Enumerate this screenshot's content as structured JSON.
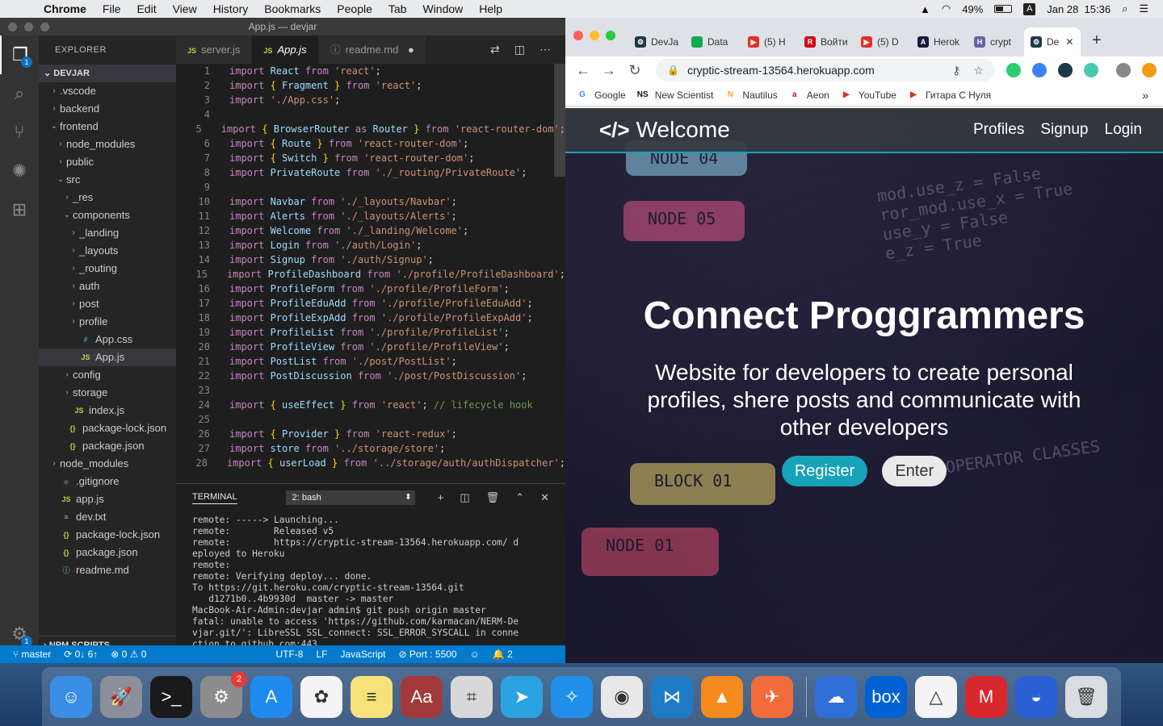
{
  "menubar": {
    "app": "Chrome",
    "items": [
      "File",
      "Edit",
      "View",
      "History",
      "Bookmarks",
      "People",
      "Tab",
      "Window",
      "Help"
    ],
    "battery": "49%",
    "input_source": "A",
    "datetime": "Jan 28  15:36"
  },
  "vscode": {
    "title": "App.js — devjar",
    "explorer_header": "EXPLORER",
    "project": "DEVJAR",
    "activity_badge": "1",
    "settings_badge": "1",
    "tree": [
      {
        "label": ".vscode",
        "indent": 1,
        "type": "folder-closed"
      },
      {
        "label": "backend",
        "indent": 1,
        "type": "folder-closed"
      },
      {
        "label": "frontend",
        "indent": 1,
        "type": "folder-open"
      },
      {
        "label": "node_modules",
        "indent": 2,
        "type": "folder-closed"
      },
      {
        "label": "public",
        "indent": 2,
        "type": "folder-closed"
      },
      {
        "label": "src",
        "indent": 2,
        "type": "folder-open"
      },
      {
        "label": "_res",
        "indent": 3,
        "type": "folder-closed"
      },
      {
        "label": "components",
        "indent": 3,
        "type": "folder-open"
      },
      {
        "label": "_landing",
        "indent": 4,
        "type": "folder-closed"
      },
      {
        "label": "_layouts",
        "indent": 4,
        "type": "folder-closed"
      },
      {
        "label": "_routing",
        "indent": 4,
        "type": "folder-closed"
      },
      {
        "label": "auth",
        "indent": 4,
        "type": "folder-closed"
      },
      {
        "label": "post",
        "indent": 4,
        "type": "folder-closed"
      },
      {
        "label": "profile",
        "indent": 4,
        "type": "folder-closed"
      },
      {
        "label": "App.css",
        "indent": 4,
        "type": "css"
      },
      {
        "label": "App.js",
        "indent": 4,
        "type": "js",
        "selected": true
      },
      {
        "label": "config",
        "indent": 3,
        "type": "folder-closed"
      },
      {
        "label": "storage",
        "indent": 3,
        "type": "folder-closed"
      },
      {
        "label": "index.js",
        "indent": 3,
        "type": "js"
      },
      {
        "label": "package-lock.json",
        "indent": 2,
        "type": "json"
      },
      {
        "label": "package.json",
        "indent": 2,
        "type": "json"
      },
      {
        "label": "node_modules",
        "indent": 1,
        "type": "folder-closed"
      },
      {
        "label": ".gitignore",
        "indent": 1,
        "type": "git"
      },
      {
        "label": "app.js",
        "indent": 1,
        "type": "js"
      },
      {
        "label": "dev.txt",
        "indent": 1,
        "type": "txt"
      },
      {
        "label": "package-lock.json",
        "indent": 1,
        "type": "json"
      },
      {
        "label": "package.json",
        "indent": 1,
        "type": "json"
      },
      {
        "label": "readme.md",
        "indent": 1,
        "type": "info"
      }
    ],
    "npm_scripts": "NPM SCRIPTS",
    "tabs": [
      {
        "label": "server.js",
        "icon": "JS"
      },
      {
        "label": "App.js",
        "icon": "JS",
        "active": true
      },
      {
        "label": "readme.md",
        "icon": "ⓘ",
        "dirty": "●"
      }
    ],
    "code_lines": [
      [
        [
          "kw",
          "import "
        ],
        [
          "id",
          "React"
        ],
        [
          "kw",
          " from "
        ],
        [
          "str",
          "'react'"
        ],
        [
          "code",
          ";"
        ]
      ],
      [
        [
          "kw",
          "import "
        ],
        [
          "pn",
          "{ "
        ],
        [
          "id",
          "Fragment"
        ],
        [
          "pn",
          " }"
        ],
        [
          "kw",
          " from "
        ],
        [
          "str",
          "'react'"
        ],
        [
          "code",
          ";"
        ]
      ],
      [
        [
          "kw",
          "import "
        ],
        [
          "str",
          "'./App.css'"
        ],
        [
          "code",
          ";"
        ]
      ],
      [],
      [
        [
          "kw",
          "import "
        ],
        [
          "pn",
          "{ "
        ],
        [
          "id",
          "BrowserRouter"
        ],
        [
          "kw",
          " as "
        ],
        [
          "id",
          "Router"
        ],
        [
          "pn",
          " }"
        ],
        [
          "kw",
          " from "
        ],
        [
          "str",
          "'react-router-dom'"
        ],
        [
          "code",
          ";"
        ]
      ],
      [
        [
          "kw",
          "import "
        ],
        [
          "pn",
          "{ "
        ],
        [
          "id",
          "Route"
        ],
        [
          "pn",
          " }"
        ],
        [
          "kw",
          " from "
        ],
        [
          "str",
          "'react-router-dom'"
        ],
        [
          "code",
          ";"
        ]
      ],
      [
        [
          "kw",
          "import "
        ],
        [
          "pn",
          "{ "
        ],
        [
          "id",
          "Switch"
        ],
        [
          "pn",
          " }"
        ],
        [
          "kw",
          " from "
        ],
        [
          "str",
          "'react-router-dom'"
        ],
        [
          "code",
          ";"
        ]
      ],
      [
        [
          "kw",
          "import "
        ],
        [
          "id",
          "PrivateRoute"
        ],
        [
          "kw",
          " from "
        ],
        [
          "str",
          "'./_routing/PrivateRoute'"
        ],
        [
          "code",
          ";"
        ]
      ],
      [],
      [
        [
          "kw",
          "import "
        ],
        [
          "id",
          "Navbar"
        ],
        [
          "kw",
          " from "
        ],
        [
          "str",
          "'./_layouts/Navbar'"
        ],
        [
          "code",
          ";"
        ]
      ],
      [
        [
          "kw",
          "import "
        ],
        [
          "id",
          "Alerts"
        ],
        [
          "kw",
          " from "
        ],
        [
          "str",
          "'./_layouts/Alerts'"
        ],
        [
          "code",
          ";"
        ]
      ],
      [
        [
          "kw",
          "import "
        ],
        [
          "id",
          "Welcome"
        ],
        [
          "kw",
          " from "
        ],
        [
          "str",
          "'./_landing/Welcome'"
        ],
        [
          "code",
          ";"
        ]
      ],
      [
        [
          "kw",
          "import "
        ],
        [
          "id",
          "Login"
        ],
        [
          "kw",
          " from "
        ],
        [
          "str",
          "'./auth/Login'"
        ],
        [
          "code",
          ";"
        ]
      ],
      [
        [
          "kw",
          "import "
        ],
        [
          "id",
          "Signup"
        ],
        [
          "kw",
          " from "
        ],
        [
          "str",
          "'./auth/Signup'"
        ],
        [
          "code",
          ";"
        ]
      ],
      [
        [
          "kw",
          "import "
        ],
        [
          "id",
          "ProfileDashboard"
        ],
        [
          "kw",
          " from "
        ],
        [
          "str",
          "'./profile/ProfileDashboard'"
        ],
        [
          "code",
          ";"
        ]
      ],
      [
        [
          "kw",
          "import "
        ],
        [
          "id",
          "ProfileForm"
        ],
        [
          "kw",
          " from "
        ],
        [
          "str",
          "'./profile/ProfileForm'"
        ],
        [
          "code",
          ";"
        ]
      ],
      [
        [
          "kw",
          "import "
        ],
        [
          "id",
          "ProfileEduAdd"
        ],
        [
          "kw",
          " from "
        ],
        [
          "str",
          "'./profile/ProfileEduAdd'"
        ],
        [
          "code",
          ";"
        ]
      ],
      [
        [
          "kw",
          "import "
        ],
        [
          "id",
          "ProfileExpAdd"
        ],
        [
          "kw",
          " from "
        ],
        [
          "str",
          "'./profile/ProfileExpAdd'"
        ],
        [
          "code",
          ";"
        ]
      ],
      [
        [
          "kw",
          "import "
        ],
        [
          "id",
          "ProfileList"
        ],
        [
          "kw",
          " from "
        ],
        [
          "str",
          "'./profile/ProfileList'"
        ],
        [
          "code",
          ";"
        ]
      ],
      [
        [
          "kw",
          "import "
        ],
        [
          "id",
          "ProfileView"
        ],
        [
          "kw",
          " from "
        ],
        [
          "str",
          "'./profile/ProfileView'"
        ],
        [
          "code",
          ";"
        ]
      ],
      [
        [
          "kw",
          "import "
        ],
        [
          "id",
          "PostList"
        ],
        [
          "kw",
          " from "
        ],
        [
          "str",
          "'./post/PostList'"
        ],
        [
          "code",
          ";"
        ]
      ],
      [
        [
          "kw",
          "import "
        ],
        [
          "id",
          "PostDiscussion"
        ],
        [
          "kw",
          " from "
        ],
        [
          "str",
          "'./post/PostDiscussion'"
        ],
        [
          "code",
          ";"
        ]
      ],
      [],
      [
        [
          "kw",
          "import "
        ],
        [
          "pn",
          "{ "
        ],
        [
          "id",
          "useEffect"
        ],
        [
          "pn",
          " }"
        ],
        [
          "kw",
          " from "
        ],
        [
          "str",
          "'react'"
        ],
        [
          "code",
          "; "
        ],
        [
          "cm",
          "// lifecycle hook"
        ]
      ],
      [],
      [
        [
          "kw",
          "import "
        ],
        [
          "pn",
          "{ "
        ],
        [
          "id",
          "Provider"
        ],
        [
          "pn",
          " }"
        ],
        [
          "kw",
          " from "
        ],
        [
          "str",
          "'react-redux'"
        ],
        [
          "code",
          ";"
        ]
      ],
      [
        [
          "kw",
          "import "
        ],
        [
          "id",
          "store"
        ],
        [
          "kw",
          " from "
        ],
        [
          "str",
          "'../storage/store'"
        ],
        [
          "code",
          ";"
        ]
      ],
      [
        [
          "kw",
          "import "
        ],
        [
          "pn",
          "{ "
        ],
        [
          "id",
          "userLoad"
        ],
        [
          "pn",
          " }"
        ],
        [
          "kw",
          " from "
        ],
        [
          "str",
          "'../storage/auth/authDispatcher'"
        ],
        [
          "code",
          ";"
        ]
      ]
    ],
    "terminal": {
      "title": "TERMINAL",
      "shell": "2: bash",
      "lines": [
        "remote: -----> Launching...",
        "remote:        Released v5",
        "remote:        https://cryptic-stream-13564.herokuapp.com/ d",
        "eployed to Heroku",
        "remote:",
        "remote: Verifying deploy... done.",
        "To https://git.heroku.com/cryptic-stream-13564.git",
        "   d1271b0..4b9930d  master -> master",
        "MacBook-Air-Admin:devjar admin$ git push origin master",
        "fatal: unable to access 'https://github.com/karmacan/NERM-De",
        "vjar.git/': LibreSSL SSL_connect: SSL_ERROR_SYSCALL in conne",
        "ction to github.com:443",
        "MacBook-Air-Admin:devjar admin$ ▯"
      ]
    },
    "status": {
      "branch": "⑂ master",
      "sync": "⟳ 0↓ 6↑",
      "problems": "⊗ 0 ⚠ 0",
      "encoding": "UTF-8",
      "eol": "LF",
      "language": "JavaScript",
      "port": "⊘ Port : 5500",
      "feedback": "☺",
      "notifications": "🔔 2"
    }
  },
  "chrome": {
    "tabs": [
      {
        "label": "DevJa",
        "fav_color": "#1a3a4a",
        "fav_text": "⚙"
      },
      {
        "label": "Data",
        "fav_color": "#13aa52",
        "fav_text": ""
      },
      {
        "label": "(5) H",
        "fav_color": "#e52d27",
        "fav_text": "▶"
      },
      {
        "label": "Войти",
        "fav_color": "#d0021b",
        "fav_text": "R"
      },
      {
        "label": "(5) D",
        "fav_color": "#e52d27",
        "fav_text": "▶"
      },
      {
        "label": "Herok",
        "fav_color": "#1b1b3a",
        "fav_text": "A"
      },
      {
        "label": "crypt",
        "fav_color": "#6762a6",
        "fav_text": "H"
      },
      {
        "label": "De",
        "fav_color": "#1a3a4a",
        "fav_text": "⚙",
        "active": true
      }
    ],
    "new_tab": "+",
    "url": "cryptic-stream-13564.herokuapp.com",
    "bookmarks": [
      {
        "label": "Google",
        "fav": "G",
        "color": "#4285f4"
      },
      {
        "label": "New Scientist",
        "fav": "NS",
        "color": "#111"
      },
      {
        "label": "Nautilus",
        "fav": "N",
        "color": "#f5a623"
      },
      {
        "label": "Aeon",
        "fav": "a",
        "color": "#b71c1c"
      },
      {
        "label": "YouTube",
        "fav": "▶",
        "color": "#e52d27"
      },
      {
        "label": "Гитара С Нуля",
        "fav": "▶",
        "color": "#e52d27"
      }
    ]
  },
  "site": {
    "brand": "Welcome",
    "brand_icon": "</>",
    "nav": [
      "Profiles",
      "Signup",
      "Login"
    ],
    "heading": "Connect Proggrammers",
    "lead": "Website for developers to create personal profiles, shere posts and communicate with other developers",
    "register": "Register",
    "enter": "Enter",
    "background_text": [
      "NODE 04",
      "NODE 05",
      "BLOCK 01",
      "NODE 01",
      "OPERATOR CLASSES"
    ]
  },
  "dock": {
    "apps": [
      {
        "name": "finder-icon",
        "color": "#3a8ee6",
        "glyph": "☺"
      },
      {
        "name": "launchpad-icon",
        "color": "#8a8f99",
        "glyph": "🚀"
      },
      {
        "name": "terminal-icon",
        "color": "#1a1a1a",
        "glyph": ">_"
      },
      {
        "name": "system-preferences-icon",
        "color": "#8c8c8c",
        "glyph": "⚙",
        "badge": "2"
      },
      {
        "name": "app-store-icon",
        "color": "#1e8af0",
        "glyph": "A"
      },
      {
        "name": "photos-icon",
        "color": "#f4f4f4",
        "glyph": "✿"
      },
      {
        "name": "notes-icon",
        "color": "#f7e27a",
        "glyph": "≡"
      },
      {
        "name": "dictionary-icon",
        "color": "#a23a3a",
        "glyph": "Aa"
      },
      {
        "name": "calculator-icon",
        "color": "#d8d8d8",
        "glyph": "⌗"
      },
      {
        "name": "telegram-icon",
        "color": "#2aa3e0",
        "glyph": "➤"
      },
      {
        "name": "safari-icon",
        "color": "#1f8fea",
        "glyph": "✧"
      },
      {
        "name": "chrome-icon",
        "color": "#e8e8e8",
        "glyph": "◉"
      },
      {
        "name": "vscode-icon",
        "color": "#1e7cc6",
        "glyph": "⋈"
      },
      {
        "name": "vlc-icon",
        "color": "#f68a1e",
        "glyph": "▲"
      },
      {
        "name": "postman-icon",
        "color": "#f26b3a",
        "glyph": "✈"
      },
      {
        "name": "separator"
      },
      {
        "name": "icloud-icon",
        "color": "#2f6fd8",
        "glyph": "☁"
      },
      {
        "name": "box-icon",
        "color": "#0061d5",
        "glyph": "box"
      },
      {
        "name": "google-drive-icon",
        "color": "#f4f4f4",
        "glyph": "△"
      },
      {
        "name": "mega-icon",
        "color": "#d9272e",
        "glyph": "M"
      },
      {
        "name": "yandex-disk-icon",
        "color": "#2a5fd6",
        "glyph": "◒"
      },
      {
        "name": "trash-icon",
        "color": "#d9dde2",
        "glyph": "🗑"
      }
    ]
  }
}
